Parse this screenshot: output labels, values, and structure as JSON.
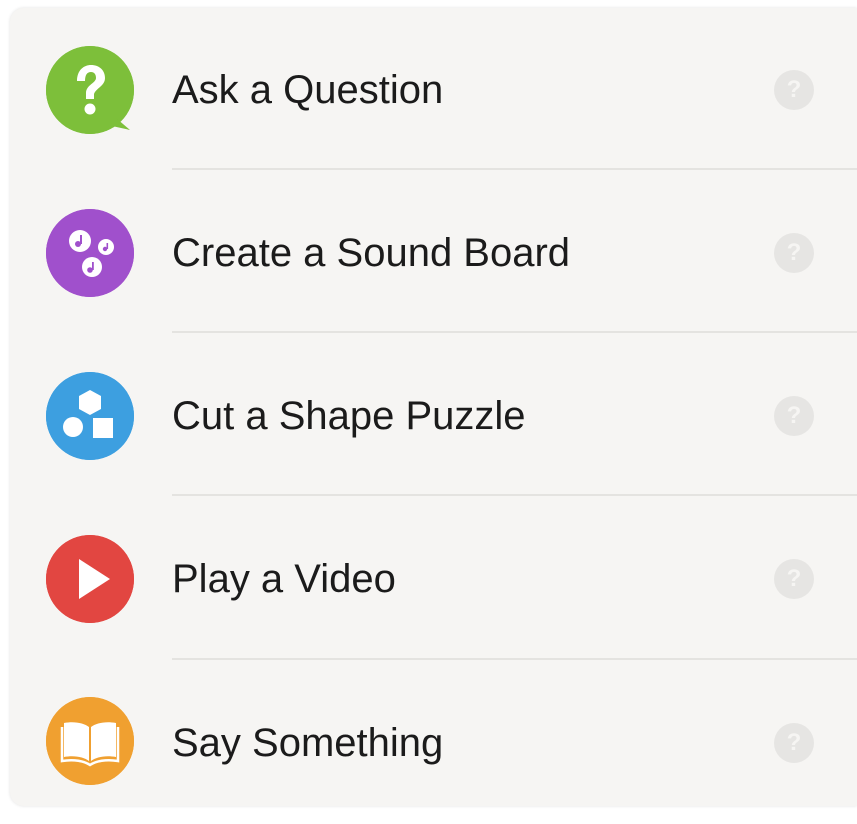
{
  "menu": {
    "items": [
      {
        "label": "Ask a Question",
        "icon": "question-bubble-icon",
        "color": "#7dbf3a",
        "help_glyph": "?"
      },
      {
        "label": "Create a Sound Board",
        "icon": "music-notes-icon",
        "color": "#a050cc",
        "help_glyph": "?"
      },
      {
        "label": "Cut a Shape Puzzle",
        "icon": "shapes-icon",
        "color": "#3d9fe0",
        "help_glyph": "?"
      },
      {
        "label": "Play a Video",
        "icon": "play-icon",
        "color": "#e24641",
        "help_glyph": "?"
      },
      {
        "label": "Say Something",
        "icon": "open-book-icon",
        "color": "#f0a030",
        "help_glyph": "?"
      }
    ]
  },
  "colors": {
    "panel_background": "#f6f5f3",
    "text": "#1b1b1b",
    "help_circle": "#e6e5e3",
    "divider": "#e4e3e0"
  }
}
